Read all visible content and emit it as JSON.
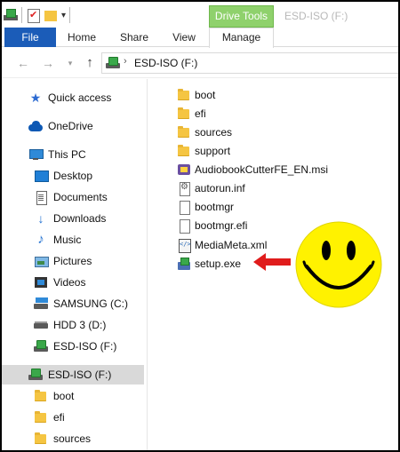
{
  "window": {
    "title": "ESD-ISO (F:)",
    "contextual_tab": "Drive Tools"
  },
  "ribbon": {
    "tabs": [
      "File",
      "Home",
      "Share",
      "View",
      "Manage"
    ]
  },
  "address": {
    "path": "ESD-ISO (F:)",
    "icon": "drive-green-icon"
  },
  "nav": {
    "quick_access": "Quick access",
    "onedrive": "OneDrive",
    "this_pc": "This PC",
    "items": [
      {
        "label": "Desktop",
        "icon": "desktop-icon"
      },
      {
        "label": "Documents",
        "icon": "documents-icon"
      },
      {
        "label": "Downloads",
        "icon": "downloads-icon"
      },
      {
        "label": "Music",
        "icon": "music-icon"
      },
      {
        "label": "Pictures",
        "icon": "pictures-icon"
      },
      {
        "label": "Videos",
        "icon": "videos-icon"
      },
      {
        "label": "SAMSUNG (C:)",
        "icon": "drive-windows-icon"
      },
      {
        "label": "HDD 3 (D:)",
        "icon": "drive-icon"
      },
      {
        "label": "ESD-ISO (F:)",
        "icon": "drive-green-icon"
      }
    ],
    "selected_drive": "ESD-ISO (F:)",
    "subfolders": [
      "boot",
      "efi",
      "sources"
    ]
  },
  "files": [
    {
      "name": "boot",
      "icon": "folder-icon"
    },
    {
      "name": "efi",
      "icon": "folder-icon"
    },
    {
      "name": "sources",
      "icon": "folder-icon"
    },
    {
      "name": "support",
      "icon": "folder-icon"
    },
    {
      "name": "AudiobookCutterFE_EN.msi",
      "icon": "msi-icon"
    },
    {
      "name": "autorun.inf",
      "icon": "settings-file-icon"
    },
    {
      "name": "bootmgr",
      "icon": "file-icon"
    },
    {
      "name": "bootmgr.efi",
      "icon": "file-icon"
    },
    {
      "name": "MediaMeta.xml",
      "icon": "xml-icon"
    },
    {
      "name": "setup.exe",
      "icon": "setup-icon"
    }
  ],
  "colors": {
    "file_tab": "#1b5cb8",
    "contextual_tab": "#8fd16c",
    "selection": "#d9d9d9",
    "arrow": "#e01c1c",
    "smiley": "#fff200"
  }
}
